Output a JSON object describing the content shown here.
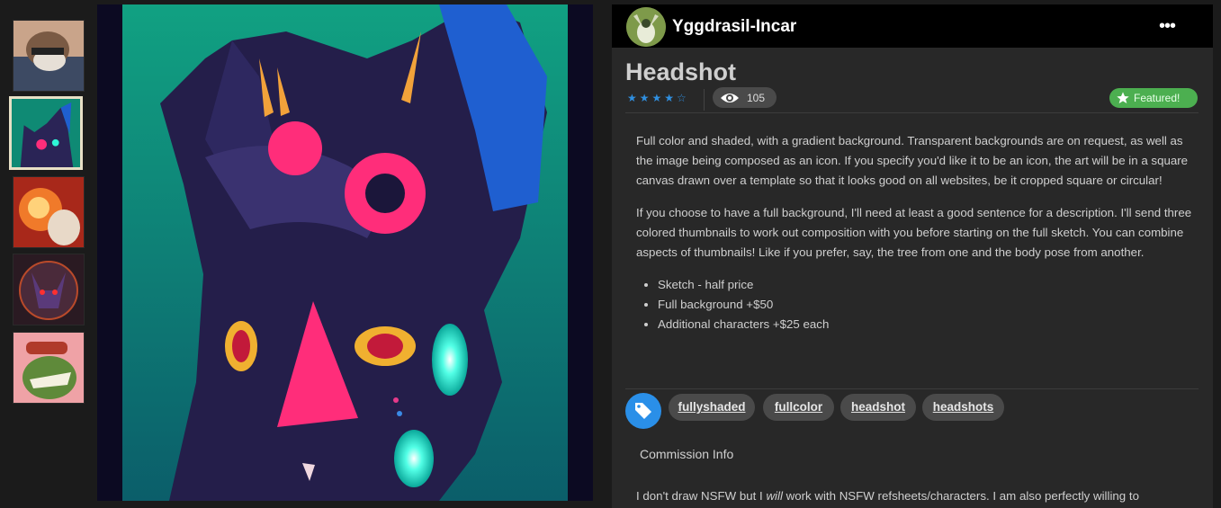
{
  "gallery": {
    "thumbnails": [
      {
        "name": "thumb-1",
        "active": false
      },
      {
        "name": "thumb-2",
        "active": true
      },
      {
        "name": "thumb-3",
        "active": false
      },
      {
        "name": "thumb-4",
        "active": false
      },
      {
        "name": "thumb-5",
        "active": false
      }
    ]
  },
  "header": {
    "username": "Yggdrasil-Incar",
    "more_icon": "more-horizontal-icon"
  },
  "submission": {
    "title": "Headshot",
    "rating_stars": "★★★★☆",
    "views": "105",
    "featured_label": "Featured!",
    "colors": {
      "accent": "#2f8fe0",
      "featured": "#4caf50",
      "panel": "#282828"
    }
  },
  "description": {
    "p1": "Full color and shaded, with a gradient background. Transparent backgrounds are on request, as well as the image being composed as an icon. If you specify you'd like it to be an icon, the art will be in a square canvas drawn over a template so that it looks good on all websites, be it cropped square or circular!",
    "p2": "If you choose to have a full background, I'll need at least a good sentence for a description. I'll send three colored thumbnails to work out composition with you before starting on the full sketch. You can combine aspects of thumbnails! Like if you prefer, say, the tree from one and the body pose from another.",
    "bullets": [
      "Sketch - half price",
      "Full background +$50",
      "Additional characters +$25 each"
    ]
  },
  "tags": [
    "fullyshaded",
    "fullcolor",
    "headshot",
    "headshots"
  ],
  "commission": {
    "section_label": "Commission Info",
    "text_before": "I don't draw NSFW but I ",
    "text_em": "will",
    "text_after": " work with NSFW refsheets/characters. I am also perfectly willing to"
  }
}
